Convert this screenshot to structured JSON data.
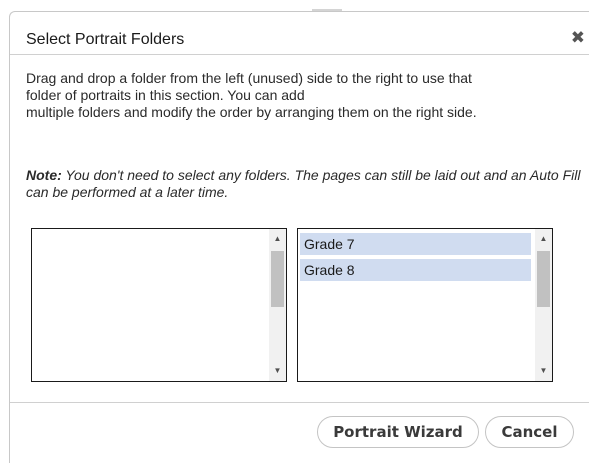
{
  "dialog": {
    "title": "Select Portrait Folders",
    "close_icon": "close-icon",
    "close_glyph": "✖",
    "description_lines": [
      "Drag and drop a folder from the left (unused) side to the right to use that",
      "folder of portraits in this section. You can add",
      "multiple folders and modify the order by arranging them on the right side."
    ],
    "note_label": "Note:",
    "note_text": " You don't need to select any folders. The pages can still be laid out and an Auto Fill can be performed at a later time."
  },
  "unused_list": {
    "items": []
  },
  "selected_list": {
    "items": [
      {
        "label": "Grade 7"
      },
      {
        "label": "Grade 8"
      }
    ]
  },
  "scroll_glyphs": {
    "up": "▲",
    "down": "▼"
  },
  "buttons": {
    "portrait_wizard": "Portrait Wizard",
    "cancel": "Cancel"
  },
  "colors": {
    "selected_item_bg": "#d0dcf0",
    "scrollbar_thumb": "#c1c1c1"
  }
}
